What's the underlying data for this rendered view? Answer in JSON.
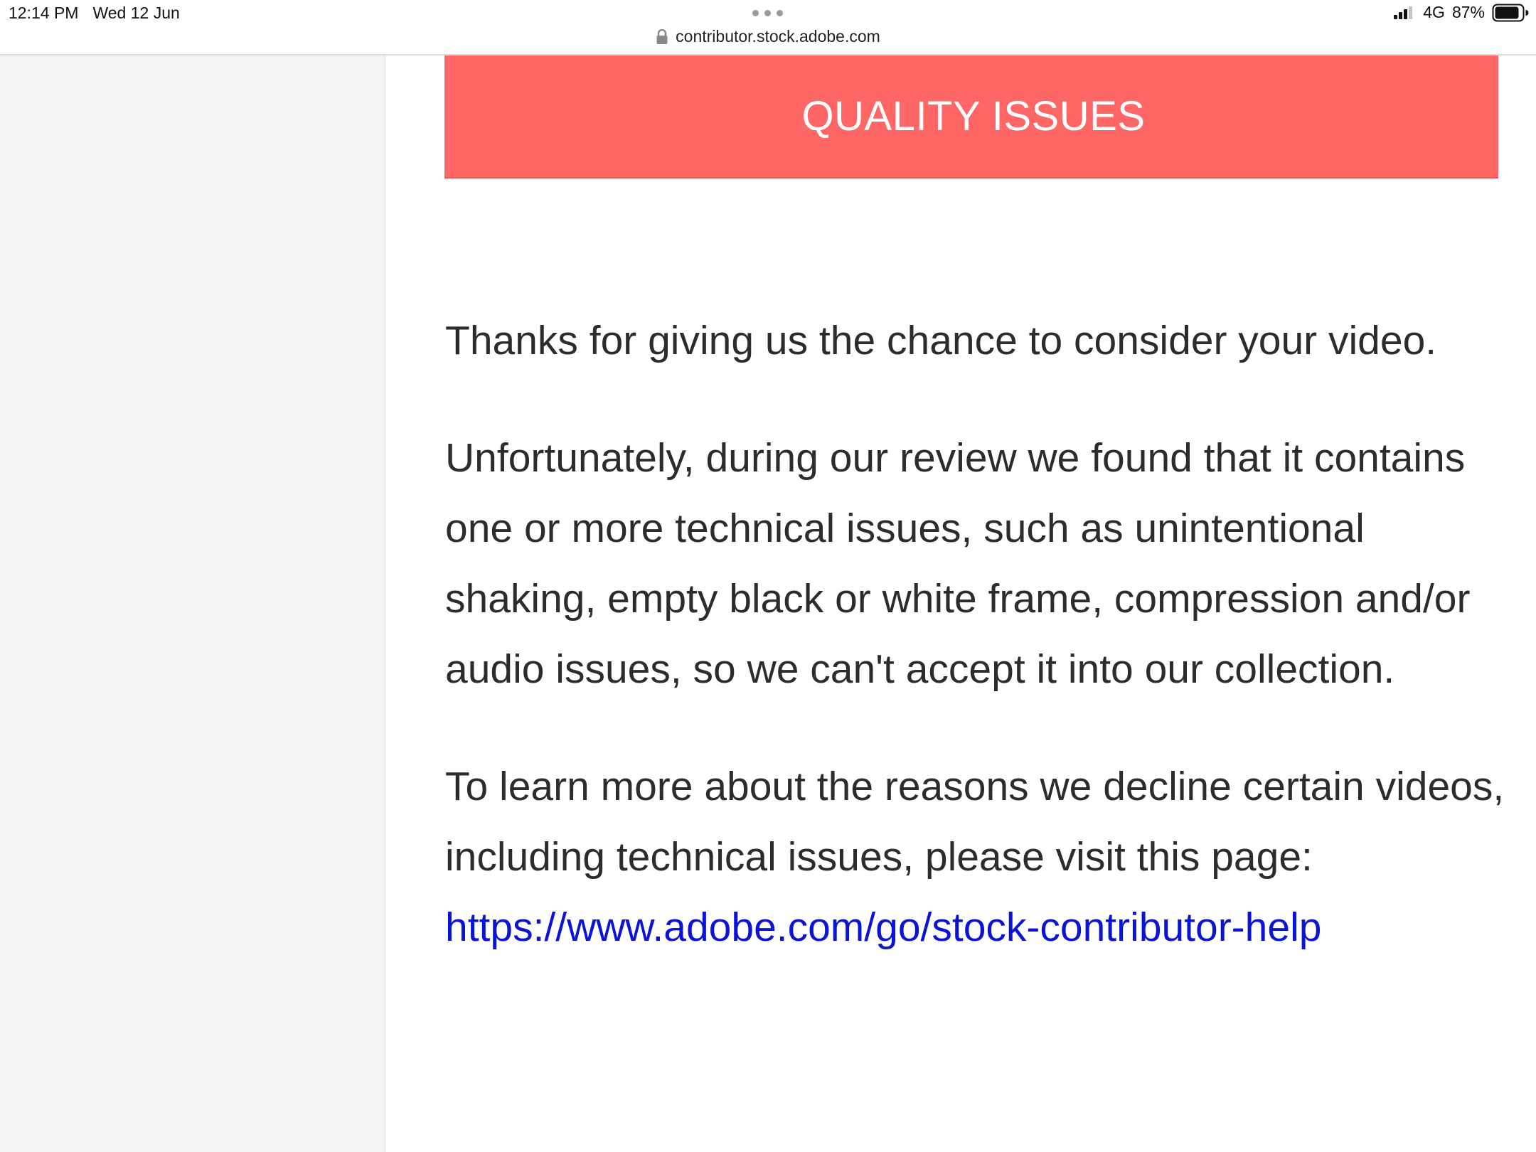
{
  "status_bar": {
    "time": "12:14 PM",
    "date": "Wed 12 Jun",
    "network": "4G",
    "battery": "87%"
  },
  "browser": {
    "url": "contributor.stock.adobe.com"
  },
  "banner": {
    "title": "QUALITY ISSUES"
  },
  "message": {
    "paragraph1": "Thanks for giving us the chance to consider your video.",
    "paragraph2": "Unfortunately, during our review we found that it contains one or more technical issues, such as unintentional shaking, empty black or white frame, compression and/or audio issues, so we can't accept it into our collection.",
    "paragraph3": "To learn more about the reasons we decline certain videos, including technical issues, please visit this page:",
    "link": "https://www.adobe.com/go/stock-contributor-help"
  },
  "colors": {
    "banner_background": "#ff6666",
    "link": "#0b14d6",
    "body_text": "#2c2c2c",
    "left_panel": "#f4f4f4"
  }
}
